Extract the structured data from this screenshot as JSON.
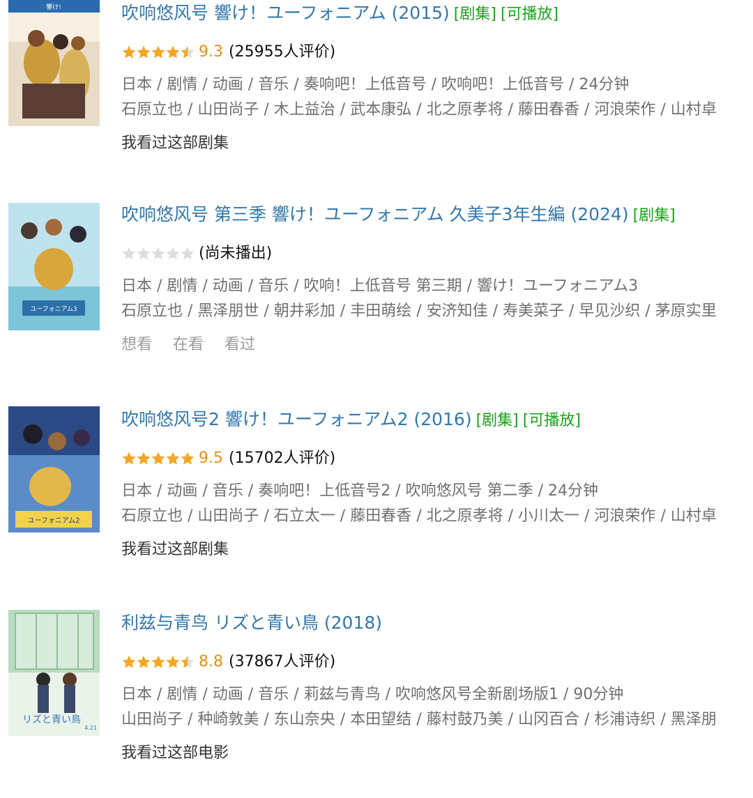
{
  "items": [
    {
      "title": "吹响悠风号 響け！ユーフォニアム (2015)",
      "tags": [
        "[剧集]",
        "[可播放]"
      ],
      "stars": 4.5,
      "score": "9.3",
      "votes": "(25955人评价)",
      "info": "日本 / 剧情 / 动画 / 音乐 / 奏响吧！上低音号 / 吹响吧！上低音号 / 24分钟",
      "cast": "石原立也 / 山田尚子 / 木上益治 / 武本康弘 / 北之原孝将 / 藤田春香 / 河浪荣作 / 山村卓",
      "action": "我看过这部剧集"
    },
    {
      "title": "吹响悠风号 第三季 響け！ユーフォニアム 久美子3年生編 (2024)",
      "tags": [
        "[剧集]"
      ],
      "stars": 0,
      "score": "",
      "votes": "(尚未播出)",
      "info": "日本 / 剧情 / 动画 / 音乐 / 吹响！上低音号 第三期 / 響け！ユーフォニアム3",
      "cast": "石原立也 / 黑泽朋世 / 朝井彩加 / 丰田萌绘 / 安济知佳 / 寿美菜子 / 早见沙织 / 茅原实里",
      "actions": [
        "想看",
        "在看",
        "看过"
      ]
    },
    {
      "title": "吹响悠风号2 響け！ユーフォニアム2 (2016)",
      "tags": [
        "[剧集]",
        "[可播放]"
      ],
      "stars": 5,
      "score": "9.5",
      "votes": "(15702人评价)",
      "info": "日本 / 动画 / 音乐 / 奏响吧！上低音号2 / 吹响悠风号 第二季 / 24分钟",
      "cast": "石原立也 / 山田尚子 / 石立太一 / 藤田春香 / 北之原孝将 / 小川太一 / 河浪荣作 / 山村卓",
      "action": "我看过这部剧集"
    },
    {
      "title": "利兹与青鸟 リズと青い鳥 (2018)",
      "tags": [],
      "stars": 4.5,
      "score": "8.8",
      "votes": "(37867人评价)",
      "info": "日本 / 剧情 / 动画 / 音乐 / 莉兹与青鸟 / 吹响悠风号全新剧场版1 / 90分钟",
      "cast": "山田尚子 / 种崎敦美 / 东山奈央 / 本田望结 / 藤村鼓乃美 / 山冈百合 / 杉浦诗织 / 黑泽朋",
      "action": "我看过这部电影"
    }
  ],
  "colors": {
    "title": "#3377aa",
    "tag": "#1aa21a",
    "star_on": "#f5a623",
    "star_off": "#dddddd",
    "score": "#e09015",
    "meta": "#6f6f6f",
    "action_muted": "#9a9a9a"
  }
}
